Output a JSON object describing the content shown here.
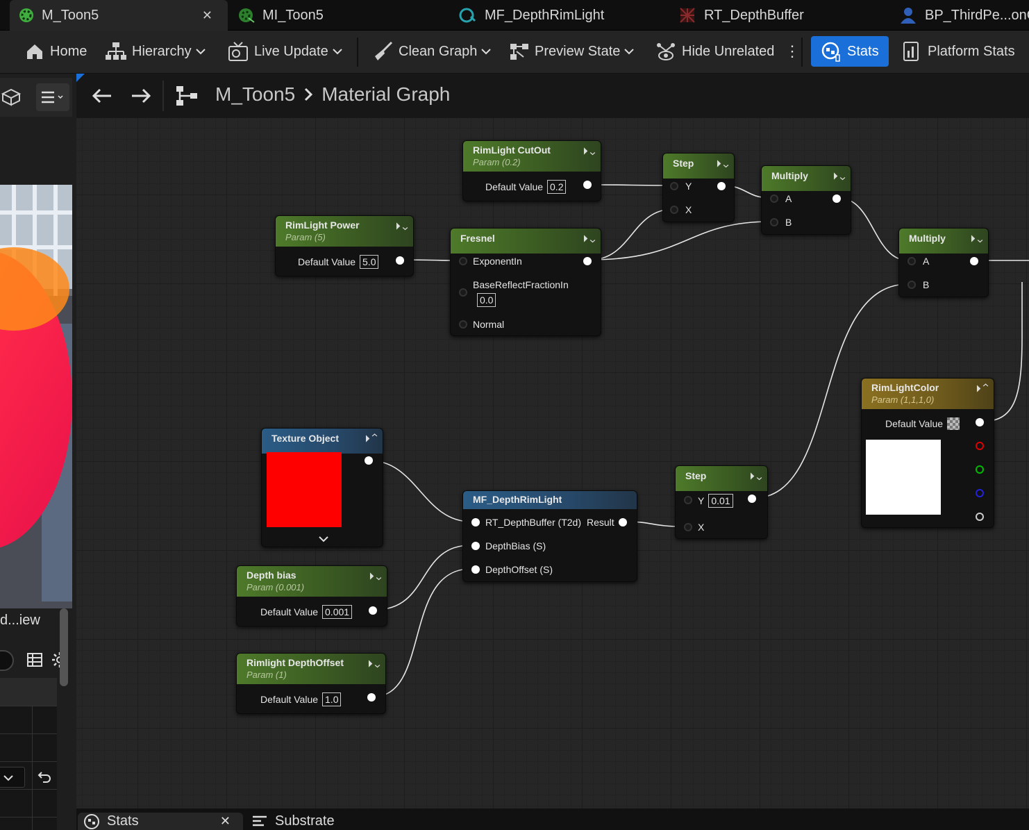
{
  "tabs": [
    {
      "label": "M_Toon5",
      "icon": "material-icon"
    },
    {
      "label": "MI_Toon5",
      "icon": "material-instance-icon"
    },
    {
      "label": "MF_DepthRimLight",
      "icon": "material-function-icon"
    },
    {
      "label": "RT_DepthBuffer",
      "icon": "render-target-icon"
    },
    {
      "label": "BP_ThirdPe...onC",
      "icon": "blueprint-character-icon"
    }
  ],
  "toolbar": {
    "home": "Home",
    "hierarchy": "Hierarchy",
    "live_update": "Live Update",
    "clean_graph": "Clean Graph",
    "preview_state": "Preview State",
    "hide_unrelated": "Hide Unrelated",
    "stats": "Stats",
    "platform_stats": "Platform Stats"
  },
  "breadcrumb": {
    "asset": "M_Toon5",
    "graph": "Material Graph"
  },
  "left_panel": {
    "label": "d...iew"
  },
  "nodes": {
    "rim_cutout": {
      "title": "RimLight CutOut",
      "subtitle": "Param (0.2)",
      "label": "Default Value",
      "value": "0.2"
    },
    "rim_power": {
      "title": "RimLight Power",
      "subtitle": "Param (5)",
      "label": "Default Value",
      "value": "5.0"
    },
    "fresnel": {
      "title": "Fresnel",
      "exponent": "ExponentIn",
      "base_reflect": "BaseReflectFractionIn",
      "base_value": "0.0",
      "normal": "Normal"
    },
    "step1": {
      "title": "Step",
      "y": "Y",
      "x": "X"
    },
    "multiply1": {
      "title": "Multiply",
      "a": "A",
      "b": "B"
    },
    "multiply2": {
      "title": "Multiply",
      "a": "A",
      "b": "B"
    },
    "rim_color": {
      "title": "RimLightColor",
      "subtitle": "Param (1,1,1,0)",
      "label": "Default Value"
    },
    "texture_object": {
      "title": "Texture Object"
    },
    "mf_depth": {
      "title": "MF_DepthRimLight",
      "in1": "RT_DepthBuffer (T2d)",
      "out": "Result",
      "in2": "DepthBias (S)",
      "in3": "DepthOffset (S)"
    },
    "step2": {
      "title": "Step",
      "y": "Y",
      "y_value": "0.01",
      "x": "X"
    },
    "depth_bias": {
      "title": "Depth bias",
      "subtitle": "Param (0.001)",
      "label": "Default Value",
      "value": "0.001"
    },
    "depth_offset": {
      "title": "Rimlight DepthOffset",
      "subtitle": "Param (1)",
      "label": "Default Value",
      "value": "1.0"
    }
  },
  "bottom_tabs": {
    "stats": "Stats",
    "substrate": "Substrate"
  },
  "colors": {
    "accent": "#1a6fd8",
    "param_header": "#4e7a2a",
    "function_header": "#2a5c86",
    "vector_param_header": "#8a7020",
    "texture_preview": "#ff0000",
    "color_preview": "#ffffff"
  }
}
